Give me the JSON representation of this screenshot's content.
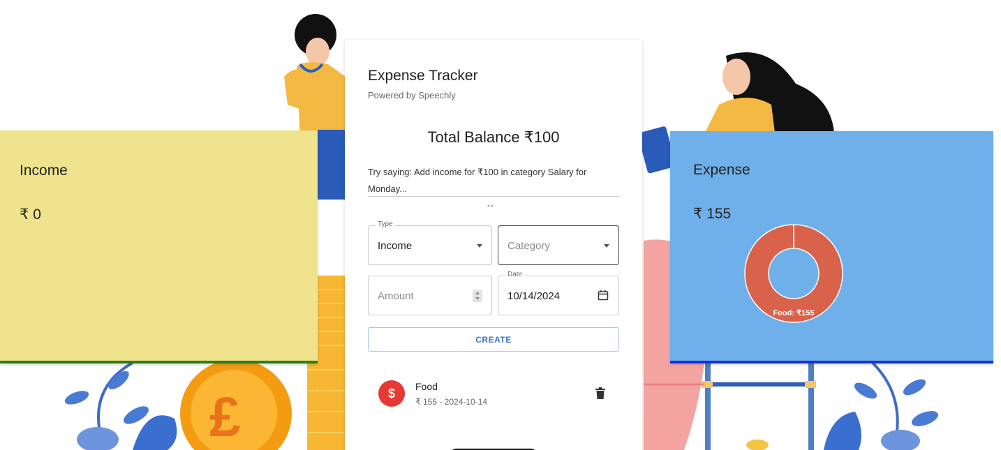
{
  "app": {
    "title": "Expense Tracker",
    "subtitle": "Powered by Speechly",
    "balance": "Total Balance ₹100",
    "hint": "Try saying: Add income for ₹100 in category Salary for Monday...",
    "hint_separator": "--"
  },
  "income": {
    "title": "Income",
    "amount": "₹ 0",
    "accent": "#2e7d1a",
    "background": "#efe48d"
  },
  "expense": {
    "title": "Expense",
    "amount": "₹ 155",
    "accent": "#1a2fd6",
    "background": "#6fb0ea",
    "chart_label": "Food: ₹155"
  },
  "chart_data": {
    "type": "pie",
    "categories": [
      "Food"
    ],
    "values": [
      155
    ],
    "colors": [
      "#d9624a"
    ],
    "title": ""
  },
  "form": {
    "type_legend": "Type",
    "type_value": "Income",
    "category_placeholder": "Category",
    "amount_placeholder": "Amount",
    "date_legend": "Date",
    "date_value": "10/14/2024",
    "create_label": "CREATE"
  },
  "transactions": [
    {
      "icon": "dollar-icon",
      "icon_symbol": "$",
      "name": "Food",
      "detail": "₹ 155 - 2024-10-14",
      "color": "#e53935"
    }
  ]
}
